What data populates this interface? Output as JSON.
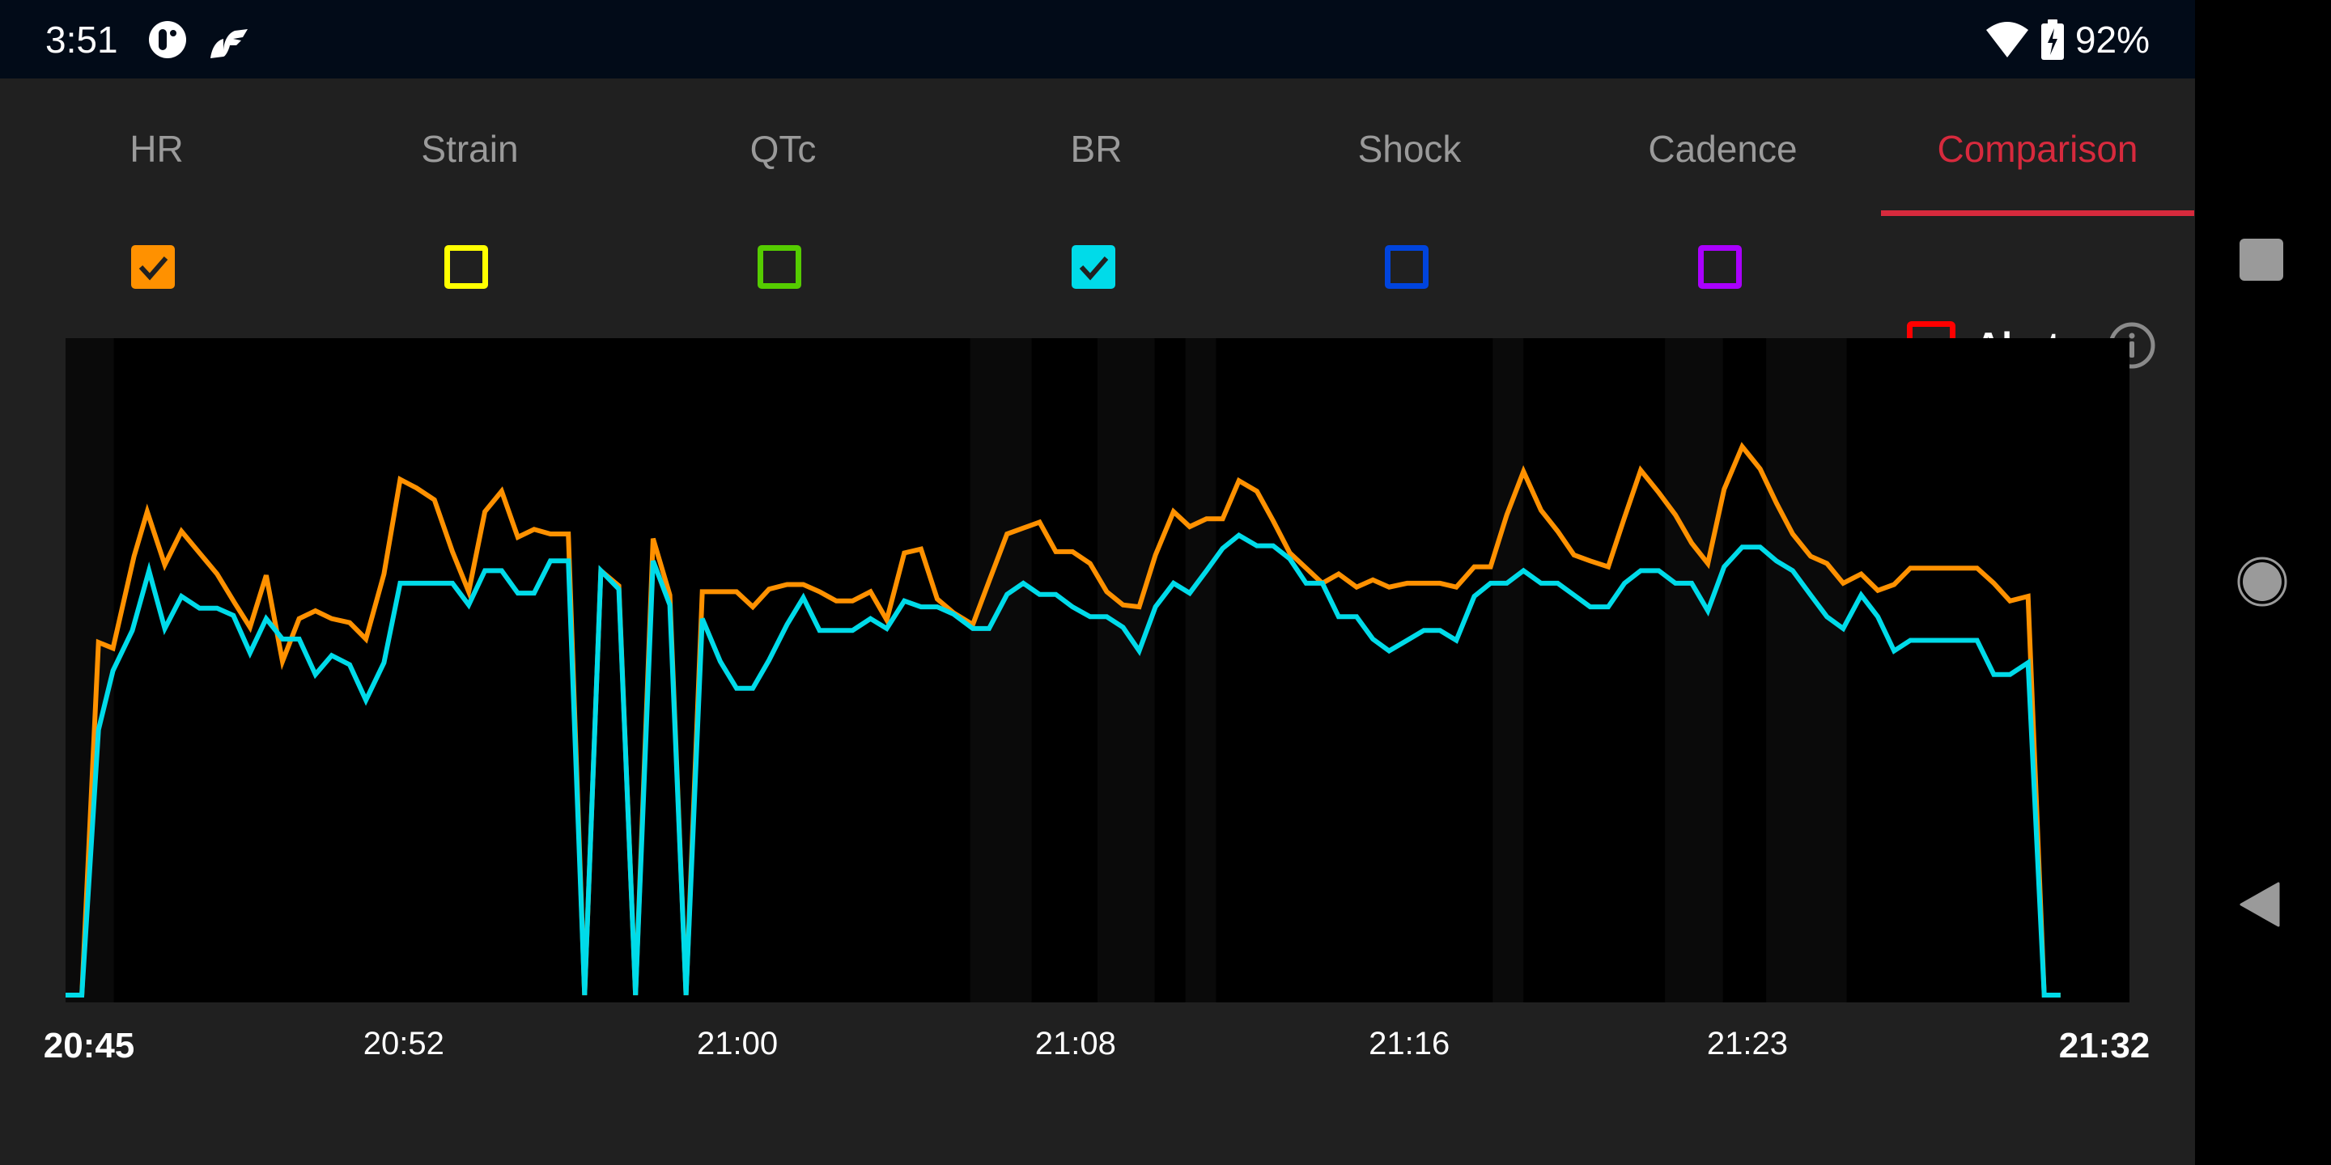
{
  "status_bar": {
    "time": "3:51",
    "battery": "92%",
    "icons": [
      "app-notification-icon",
      "app-f-icon",
      "wifi-icon",
      "battery-charging-icon"
    ]
  },
  "tabs": [
    {
      "label": "HR",
      "active": false
    },
    {
      "label": "Strain",
      "active": false
    },
    {
      "label": "QTc",
      "active": false
    },
    {
      "label": "BR",
      "active": false
    },
    {
      "label": "Shock",
      "active": false
    },
    {
      "label": "Cadence",
      "active": false
    },
    {
      "label": "Comparison",
      "active": true
    }
  ],
  "colors": {
    "accent": "#d72a3d",
    "hr": "#ff9100",
    "strain": "#ffff00",
    "qtc": "#55cc00",
    "br": "#00dbe9",
    "shock": "#0044dd",
    "cadence": "#aa00ff",
    "alerts": "#ff0000"
  },
  "series_toggles": [
    {
      "name": "HR",
      "color": "#ff9100",
      "checked": true
    },
    {
      "name": "Strain",
      "color": "#ffff00",
      "checked": false
    },
    {
      "name": "QTc",
      "color": "#55cc00",
      "checked": false
    },
    {
      "name": "BR",
      "color": "#00dbe9",
      "checked": true
    },
    {
      "name": "Shock",
      "color": "#0044dd",
      "checked": false
    },
    {
      "name": "Cadence",
      "color": "#aa00ff",
      "checked": false
    }
  ],
  "alerts": {
    "label": "Alerts",
    "checked": false,
    "color": "#ff0000"
  },
  "chart_data": {
    "type": "line",
    "title": "",
    "xlabel": "",
    "ylabel": "",
    "x_unit": "minutes since 20:45",
    "xlim": [
      0,
      47
    ],
    "ylim": [
      0,
      100
    ],
    "y_scale": "normalized (no y-axis labels shown)",
    "grid": false,
    "legend": "none (series toggled via colored checkboxes above chart)",
    "x_tick_labels": [
      {
        "t": 0,
        "label": "20:45",
        "bold": true
      },
      {
        "t": 7.7,
        "label": "20:52",
        "bold": false
      },
      {
        "t": 15.3,
        "label": "21:00",
        "bold": false
      },
      {
        "t": 23,
        "label": "21:08",
        "bold": false
      },
      {
        "t": 30.6,
        "label": "21:16",
        "bold": false
      },
      {
        "t": 38.3,
        "label": "21:23",
        "bold": false
      },
      {
        "t": 47,
        "label": "21:32",
        "bold": true
      }
    ],
    "background_bands": [
      [
        0,
        1.1
      ],
      [
        20.6,
        22.0
      ],
      [
        23.5,
        24.8
      ],
      [
        25.5,
        26.2
      ],
      [
        32.5,
        33.2
      ],
      [
        77.5,
        80.3
      ],
      [
        82.4,
        86.3
      ]
    ],
    "series": [
      {
        "name": "HR",
        "color": "#ff9100",
        "x": [
          0,
          0.37,
          0.75,
          1.08,
          1.56,
          1.86,
          2.26,
          2.64,
          3.05,
          3.45,
          3.86,
          4.2,
          4.57,
          4.94,
          5.32,
          5.69,
          6.06,
          6.47,
          6.84,
          7.25,
          7.62,
          7.99,
          8.4,
          8.81,
          9.18,
          9.55,
          9.93,
          10.3,
          10.67,
          11.04,
          11.45,
          11.82,
          12.19,
          12.6,
          12.98,
          13.38,
          13.76,
          14.13,
          14.5,
          14.91,
          15.28,
          15.65,
          16.02,
          16.43,
          16.8,
          17.17,
          17.55,
          17.92,
          18.33,
          18.7,
          19.1,
          19.48,
          19.85,
          20.22,
          20.66,
          21.03,
          21.44,
          21.81,
          22.18,
          22.55,
          22.93,
          23.33,
          23.71,
          24.08,
          24.45,
          24.82,
          25.23,
          25.6,
          25.98,
          26.35,
          26.72,
          27.13,
          27.5,
          27.88,
          28.25,
          28.62,
          28.99,
          29.4,
          29.77,
          30.14,
          30.55,
          30.93,
          31.3,
          31.67,
          32.08,
          32.45,
          32.82,
          33.2,
          33.6,
          33.98,
          34.35,
          34.72,
          35.13,
          35.5,
          35.87,
          36.28,
          36.66,
          37.03,
          37.4,
          37.77,
          38.18,
          38.59,
          38.96,
          39.33,
          39.74,
          40.11,
          40.48,
          40.89,
          41.27,
          41.64,
          42.01,
          42.42,
          42.79,
          43.16,
          43.53,
          43.91,
          44.28,
          44.69,
          45.06,
          45.43,
          47.0
        ],
        "values": [
          0,
          0,
          53.7,
          52.8,
          66.8,
          73.6,
          65.5,
          70.6,
          67.3,
          64.1,
          59.6,
          56.0,
          63.9,
          50.8,
          57.3,
          58.5,
          57.3,
          56.7,
          54.2,
          64.1,
          78.5,
          77.2,
          75.4,
          67.5,
          61.4,
          73.6,
          76.7,
          69.7,
          70.9,
          70.2,
          70.2,
          0,
          64.6,
          62.3,
          0,
          69.5,
          60.9,
          0,
          61.4,
          61.4,
          61.4,
          59.1,
          61.8,
          62.5,
          62.5,
          61.4,
          60.0,
          60.0,
          61.4,
          57.1,
          67.3,
          67.9,
          60.3,
          58.2,
          56.4,
          63.0,
          70.2,
          71.1,
          72.0,
          67.5,
          67.5,
          65.7,
          61.4,
          59.4,
          59.1,
          67.0,
          73.6,
          71.3,
          72.5,
          72.5,
          78.3,
          76.7,
          72.2,
          67.3,
          65.0,
          62.7,
          64.1,
          62.1,
          63.2,
          62.1,
          62.7,
          62.7,
          62.7,
          62.1,
          65.2,
          65.2,
          73.1,
          79.7,
          73.8,
          70.6,
          67.0,
          66.1,
          65.2,
          72.7,
          79.9,
          76.5,
          73.1,
          68.8,
          65.7,
          77.0,
          83.5,
          80.1,
          74.9,
          70.2,
          66.8,
          65.7,
          62.7,
          64.1,
          61.6,
          62.5,
          65.0,
          65.0,
          65.0,
          65.0,
          65.0,
          62.7,
          60.0,
          60.7,
          0,
          0
        ]
      },
      {
        "name": "BR",
        "color": "#00dbe9",
        "x": [
          0,
          0.37,
          0.75,
          1.08,
          1.52,
          1.9,
          2.26,
          2.64,
          3.05,
          3.45,
          3.82,
          4.2,
          4.57,
          4.94,
          5.32,
          5.69,
          6.06,
          6.47,
          6.84,
          7.25,
          7.62,
          7.99,
          8.4,
          8.81,
          9.18,
          9.55,
          9.93,
          10.3,
          10.67,
          11.04,
          11.45,
          11.82,
          12.19,
          12.6,
          12.98,
          13.38,
          13.76,
          14.13,
          14.5,
          14.91,
          15.28,
          15.65,
          16.02,
          16.43,
          16.8,
          17.17,
          17.55,
          17.92,
          18.33,
          18.7,
          19.1,
          19.48,
          19.85,
          20.22,
          20.66,
          21.03,
          21.44,
          21.81,
          22.18,
          22.55,
          22.93,
          23.33,
          23.71,
          24.08,
          24.45,
          24.82,
          25.23,
          25.6,
          25.98,
          26.35,
          26.72,
          27.13,
          27.5,
          27.88,
          28.25,
          28.62,
          28.99,
          29.4,
          29.77,
          30.14,
          30.55,
          30.93,
          31.3,
          31.67,
          32.08,
          32.45,
          32.82,
          33.2,
          33.6,
          33.98,
          34.35,
          34.72,
          35.13,
          35.5,
          35.87,
          36.28,
          36.66,
          37.03,
          37.4,
          37.77,
          38.18,
          38.59,
          38.96,
          39.33,
          39.74,
          40.11,
          40.48,
          40.89,
          41.27,
          41.64,
          42.01,
          42.42,
          42.79,
          43.16,
          43.53,
          43.91,
          44.28,
          44.69,
          45.06,
          45.43,
          47.0
        ],
        "values": [
          0,
          0,
          40.4,
          49.4,
          55.5,
          64.6,
          55.8,
          60.7,
          58.9,
          58.9,
          57.8,
          52.1,
          57.3,
          54.2,
          54.2,
          48.8,
          51.7,
          50.3,
          44.9,
          50.6,
          62.7,
          62.7,
          62.7,
          62.7,
          59.4,
          64.6,
          64.6,
          61.2,
          61.2,
          66.1,
          66.1,
          0,
          64.6,
          61.8,
          0,
          66.1,
          59.4,
          0,
          57.3,
          50.8,
          46.7,
          46.7,
          51.0,
          56.4,
          60.5,
          55.5,
          55.5,
          55.5,
          57.3,
          55.8,
          60.0,
          59.1,
          59.1,
          58.0,
          55.8,
          55.8,
          61.0,
          62.7,
          61.0,
          61.0,
          59.1,
          57.6,
          57.6,
          56.0,
          52.4,
          59.1,
          62.7,
          61.2,
          64.6,
          68.0,
          70.0,
          68.4,
          68.4,
          66.4,
          62.7,
          62.7,
          57.6,
          57.6,
          54.2,
          52.4,
          54.0,
          55.5,
          55.5,
          54.0,
          60.7,
          62.7,
          62.7,
          64.6,
          62.7,
          62.7,
          60.9,
          59.1,
          59.1,
          62.7,
          64.6,
          64.6,
          62.7,
          62.7,
          58.5,
          65.2,
          68.2,
          68.2,
          66.1,
          64.6,
          60.9,
          57.6,
          55.8,
          60.9,
          57.6,
          52.4,
          54.0,
          54.0,
          54.0,
          54.0,
          54.0,
          48.8,
          48.8,
          50.6,
          0,
          0
        ]
      }
    ]
  },
  "navbar": {
    "buttons": [
      "recents-button",
      "home-button",
      "back-button"
    ]
  }
}
